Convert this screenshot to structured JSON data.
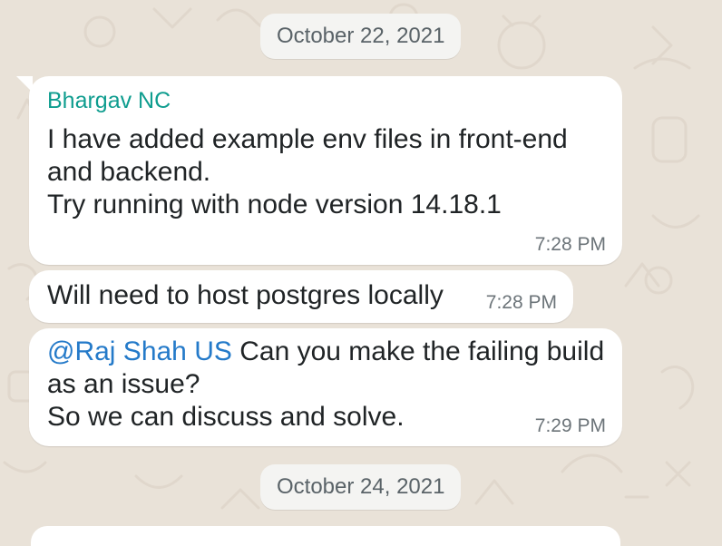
{
  "chat": {
    "date_chips": [
      {
        "label": "October 22, 2021"
      },
      {
        "label": "October 24, 2021"
      }
    ],
    "messages": [
      {
        "sender": "Bhargav NC",
        "text": "I have added example env files in front-end\nand backend.\nTry running with node version 14.18.1",
        "time": "7:28 PM"
      },
      {
        "text": "Will need to host postgres locally",
        "time": "7:28 PM"
      },
      {
        "mention": "@Raj Shah US",
        "text": " Can you make the failing build\nas an issue?\nSo we can discuss and solve.",
        "time": "7:29 PM"
      }
    ]
  },
  "colors": {
    "background": "#e9e2d8",
    "bubble": "#ffffff",
    "sender": "#0f9d8f",
    "mention": "#247ac9",
    "timestamp": "#6c7479",
    "date_chip_text": "#5a6368"
  }
}
